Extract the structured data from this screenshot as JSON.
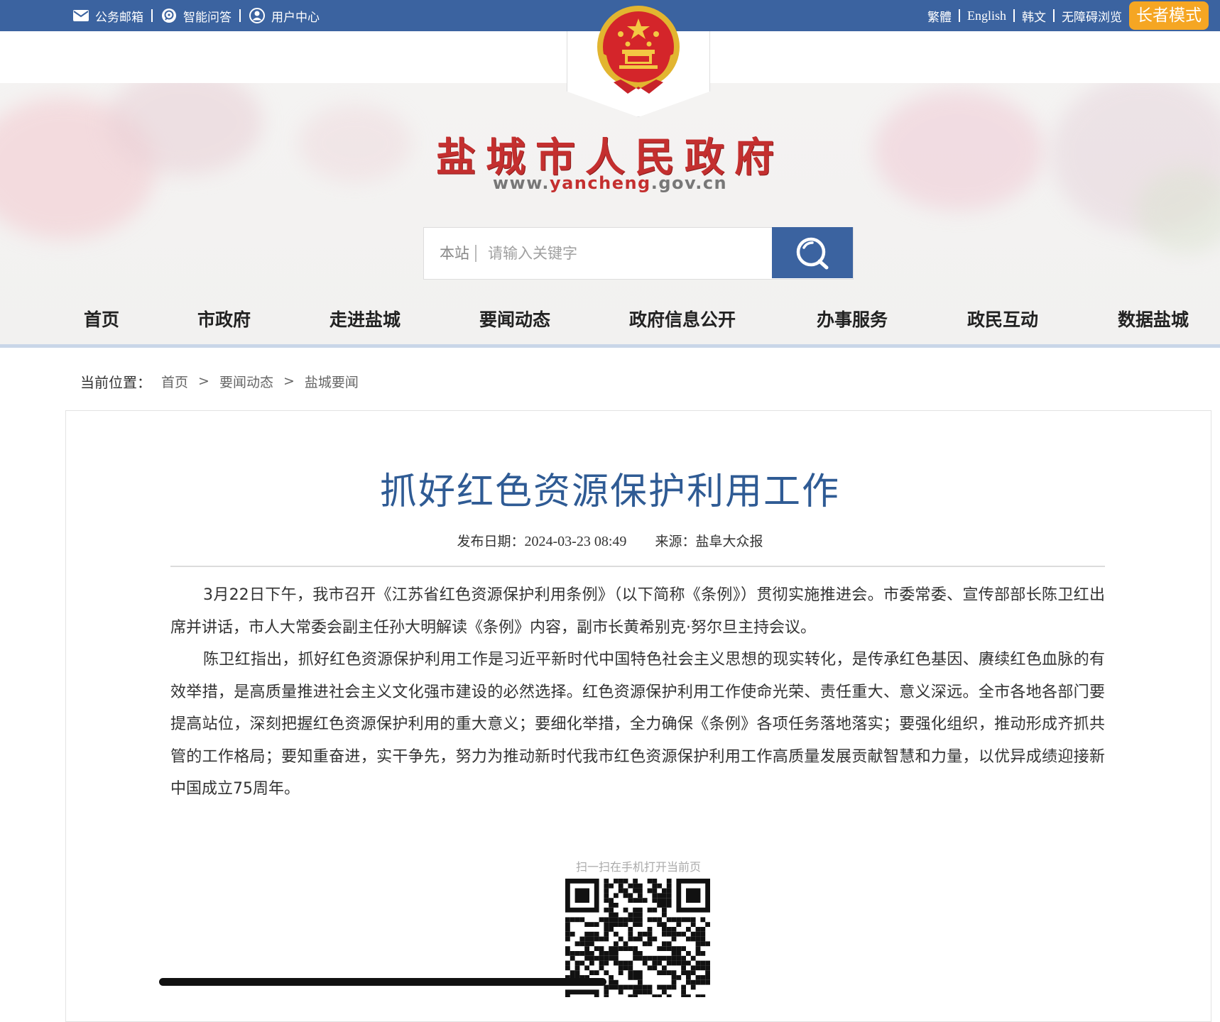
{
  "topbar": {
    "left_links": [
      {
        "label": "公务邮箱",
        "icon": "mail-icon"
      },
      {
        "label": "智能问答",
        "icon": "chat-icon"
      },
      {
        "label": "用户中心",
        "icon": "user-icon"
      }
    ],
    "right_links": {
      "traditional": "繁體",
      "english": "English",
      "korean": "韩文",
      "accessible": "无障碍浏览",
      "elder_mode": "长者模式"
    },
    "colors": {
      "bar": "#3b63a0",
      "elder_button": "#f5a623"
    }
  },
  "header": {
    "title": "盐城市人民政府",
    "url_prefix": "www.",
    "url_highlight": "yancheng",
    "url_suffix": ".gov.cn",
    "emblem": "national-emblem-icon"
  },
  "search": {
    "scope": "本站",
    "placeholder": "请输入关键字",
    "button_icon": "search-icon"
  },
  "nav": {
    "items": [
      "首页",
      "市政府",
      "走进盐城",
      "要闻动态",
      "政府信息公开",
      "办事服务",
      "政民互动",
      "数据盐城"
    ]
  },
  "breadcrumb": {
    "label": "当前位置：",
    "items": [
      "首页",
      "要闻动态",
      "盐城要闻"
    ],
    "separator": ">"
  },
  "article": {
    "title": "抓好红色资源保护利用工作",
    "date_label": "发布日期：",
    "date": "2024-03-23 08:49",
    "source_label": "来源：",
    "source": "盐阜大众报",
    "paragraphs": [
      "3月22日下午，我市召开《江苏省红色资源保护利用条例》（以下简称《条例》）贯彻实施推进会。市委常委、宣传部部长陈卫红出席并讲话，市人大常委会副主任孙大明解读《条例》内容，副市长黄希别克·努尔旦主持会议。",
      "陈卫红指出，抓好红色资源保护利用工作是习近平新时代中国特色社会主义思想的现实转化，是传承红色基因、赓续红色血脉的有效举措，是高质量推进社会主义文化强市建设的必然选择。红色资源保护利用工作使命光荣、责任重大、意义深远。全市各地各部门要提高站位，深刻把握红色资源保护利用的重大意义；要细化举措，全力确保《条例》各项任务落地落实；要强化组织，推动形成齐抓共管的工作格局；要知重奋进，实干争先，努力为推动新时代我市红色资源保护利用工作高质量发展贡献智慧和力量，以优异成绩迎接新中国成立75周年。"
    ],
    "title_color": "#2f5b94"
  },
  "qr": {
    "caption": "扫一扫在手机打开当前页"
  }
}
